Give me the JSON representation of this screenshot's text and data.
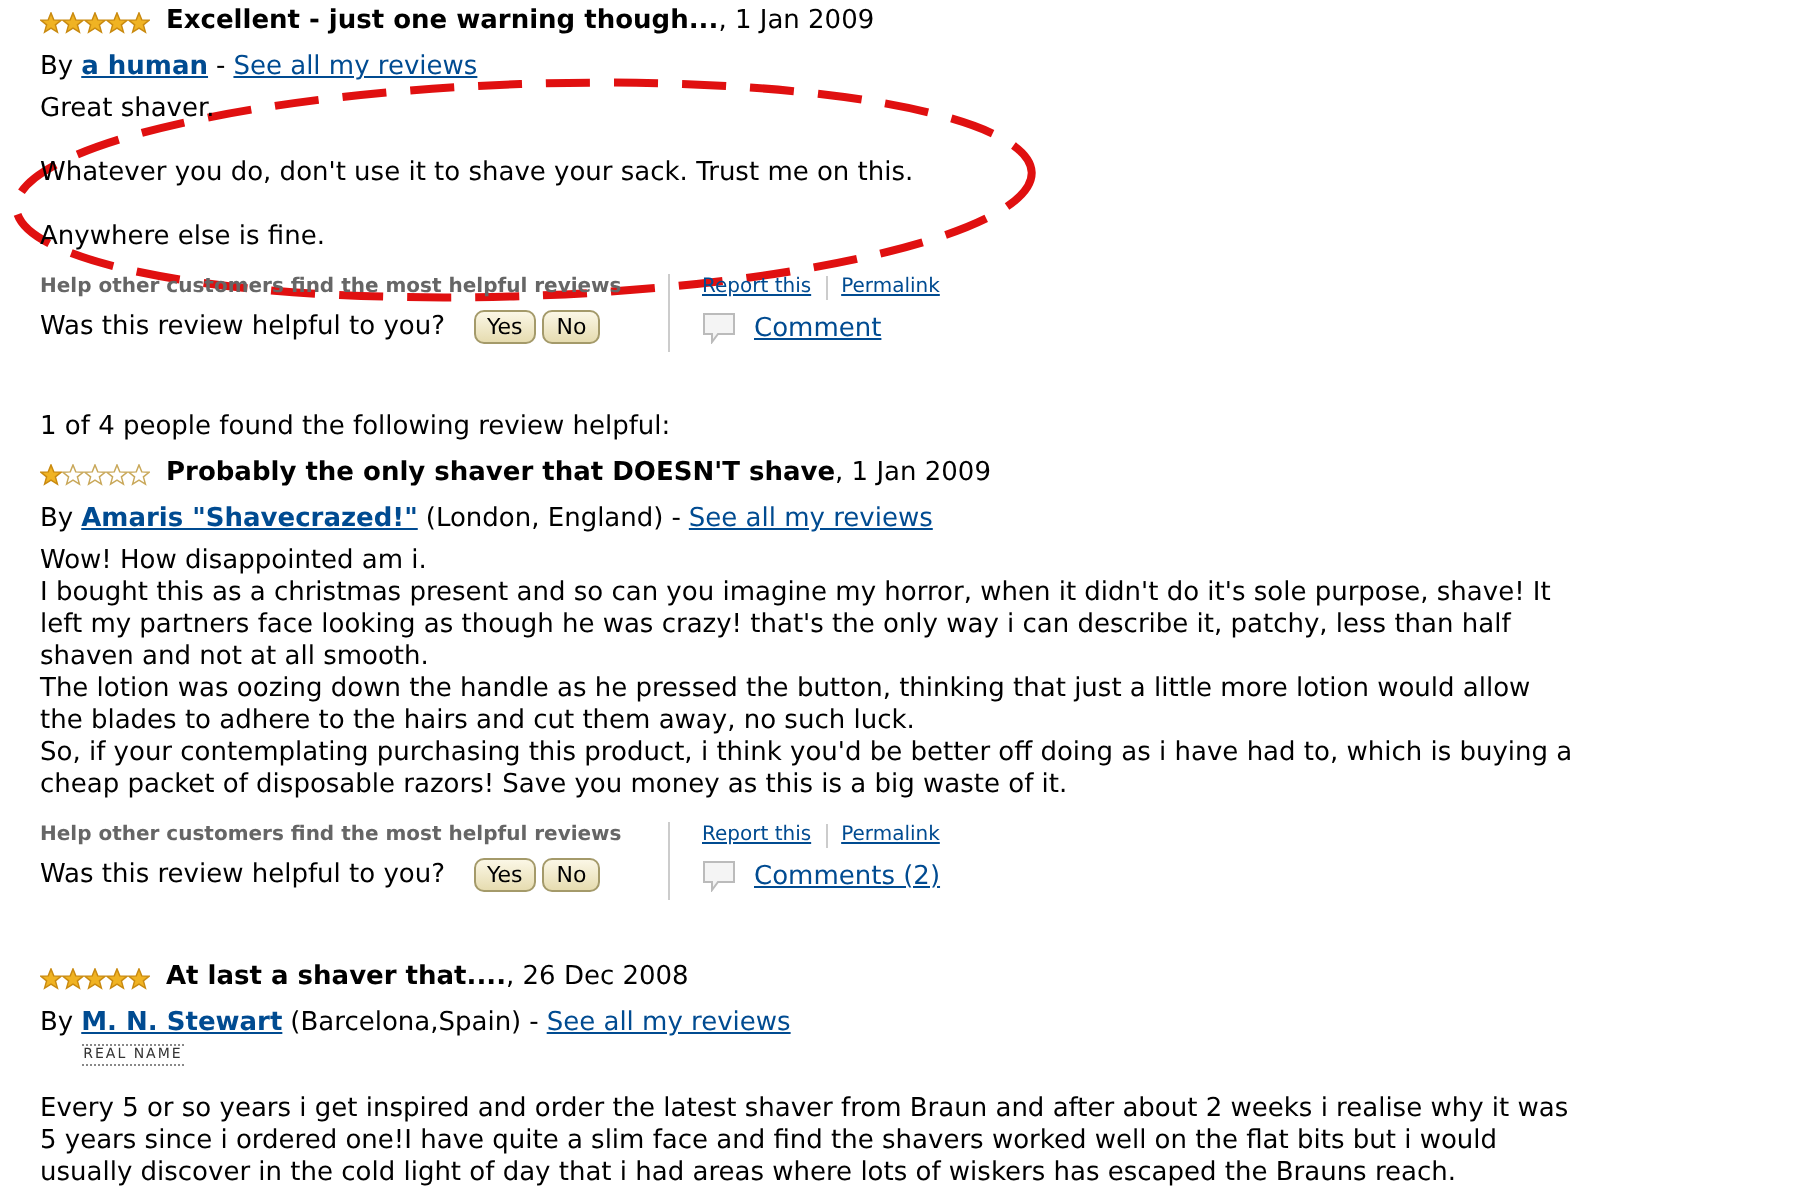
{
  "reviews": [
    {
      "stars": 5,
      "title": "Excellent - just one warning though...",
      "date": ", 1 Jan 2009",
      "by": "By",
      "author": "a human",
      "separator": "-",
      "see_all": "See all my reviews",
      "spaced_paragraphs": true,
      "body": [
        [
          "Great shaver."
        ],
        [
          "Whatever you do, don't use it to shave your sack. Trust me on this."
        ],
        [
          "Anywhere else is fine."
        ]
      ],
      "footer": {
        "help": "Help other customers find the most helpful reviews",
        "question": "Was this review helpful to you?",
        "buttons": [
          "Yes",
          "No"
        ],
        "links": [
          "Report this",
          "Permalink"
        ],
        "comment": "Comment"
      }
    },
    {
      "helpful_note": "1 of 4 people found the following review helpful:",
      "stars": 1,
      "title": "Probably the only shaver that DOESN'T shave",
      "date": ", 1 Jan 2009",
      "by": "By",
      "author": "Amaris \"Shavecrazed!\"",
      "location": "(London, England)",
      "separator": "-",
      "see_all": "See all my reviews",
      "spaced_paragraphs": false,
      "body": [
        [
          "Wow! How disappointed am i."
        ],
        [
          "I bought this as a christmas present and so can you imagine my horror, when it didn't do it's sole purpose, shave! It",
          "left my partners face looking as though he was crazy! that's the only way i can describe it, patchy, less than half",
          "shaven and not at all smooth."
        ],
        [
          "The lotion was oozing down the handle as he pressed the button, thinking that just a little more lotion would allow",
          "the blades to adhere to the hairs and cut them away, no such luck."
        ],
        [
          "So, if your contemplating purchasing this product, i think you'd be better off doing as i have had to, which is buying a",
          "cheap packet of disposable razors! Save you money as this is a big waste of it."
        ]
      ],
      "footer": {
        "help": "Help other customers find the most helpful reviews",
        "question": "Was this review helpful to you?",
        "buttons": [
          "Yes",
          "No"
        ],
        "links": [
          "Report this",
          "Permalink"
        ],
        "comment": "Comments (2)"
      }
    },
    {
      "stars": 5,
      "title": "At last a shaver that....",
      "date": ", 26 Dec 2008",
      "by": "By",
      "author": "M. N. Stewart",
      "author_badge": "REAL NAME",
      "location": "(Barcelona,Spain)",
      "separator": "-",
      "see_all": "See all my reviews",
      "spaced_paragraphs": false,
      "body": [
        [
          "Every 5 or so years i get inspired and order the latest shaver from Braun and after about 2 weeks i realise why it was",
          "5 years since i ordered one!I have quite a slim face and find the shavers worked well on the flat bits but i would",
          "usually discover in the cold light of day that i had areas where lots of wiskers has escaped the Brauns reach."
        ]
      ]
    }
  ],
  "annotation": {
    "kind": "dashed-ellipse",
    "color": "#e01010"
  }
}
